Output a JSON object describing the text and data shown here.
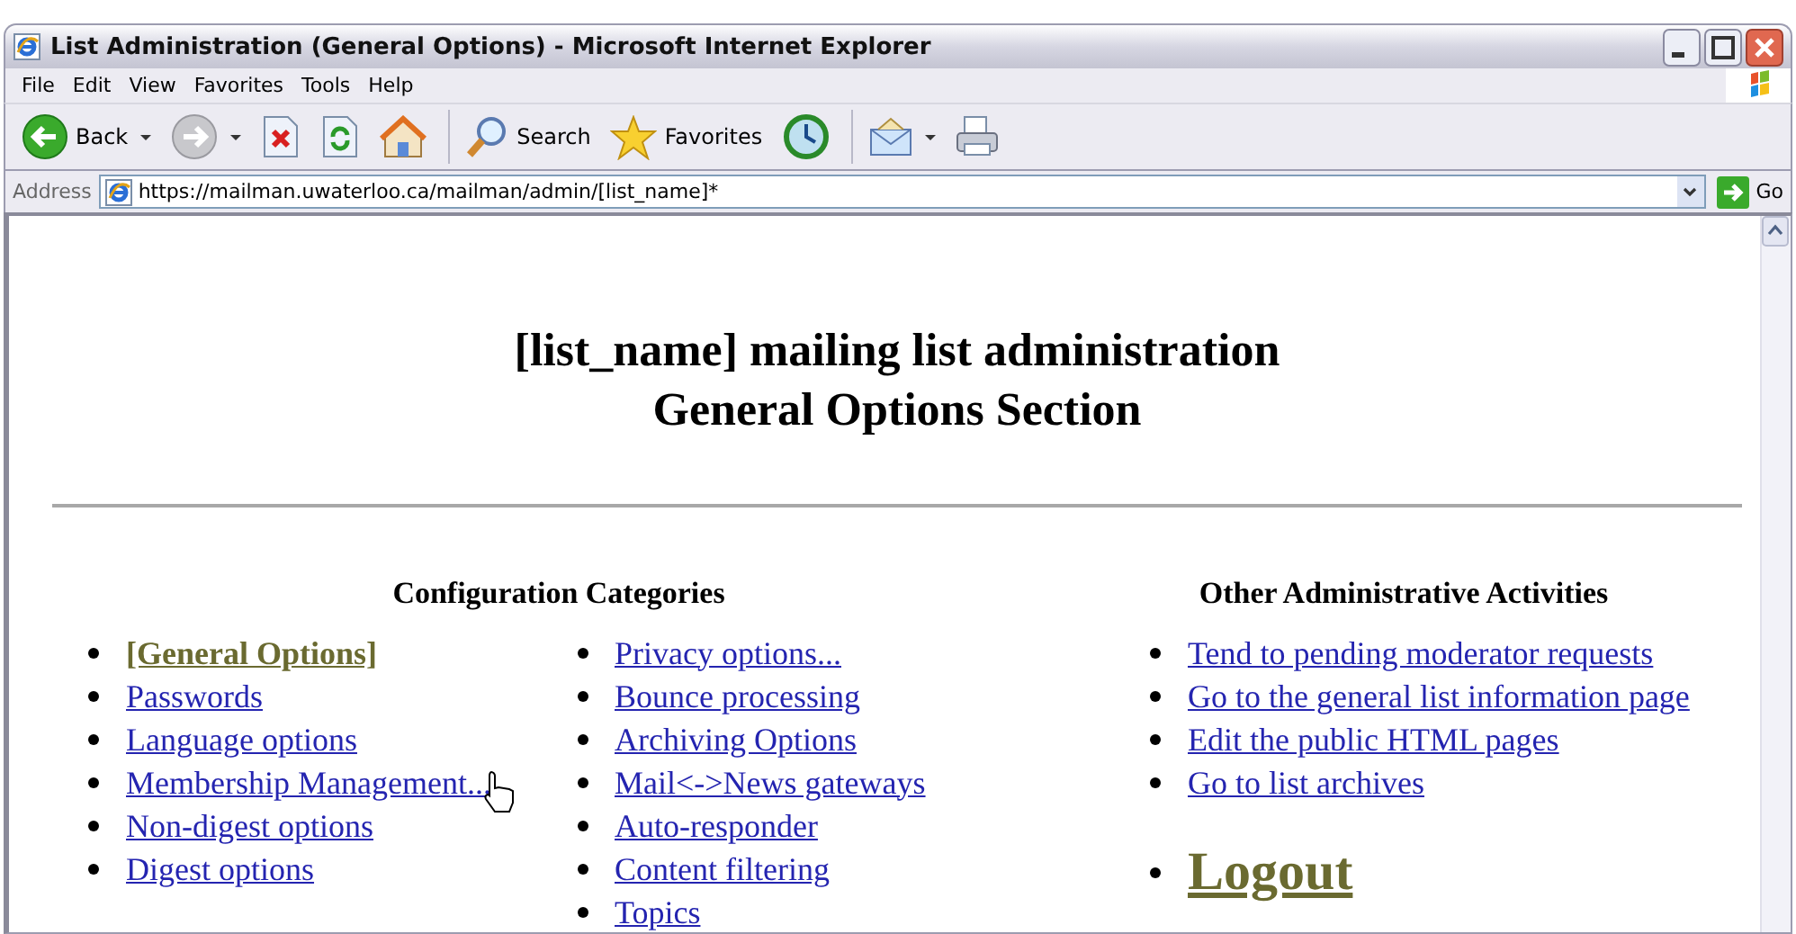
{
  "window": {
    "title": "List Administration (General Options) - Microsoft Internet Explorer"
  },
  "menu": [
    "File",
    "Edit",
    "View",
    "Favorites",
    "Tools",
    "Help"
  ],
  "toolbar": [
    {
      "kind": "back",
      "label": "Back"
    },
    {
      "kind": "forward"
    },
    {
      "kind": "stop"
    },
    {
      "kind": "refresh"
    },
    {
      "kind": "home"
    },
    {
      "kind": "search",
      "label": "Search"
    },
    {
      "kind": "favorites",
      "label": "Favorites"
    },
    {
      "kind": "history"
    },
    {
      "kind": "mail"
    },
    {
      "kind": "print"
    }
  ],
  "address_bar": {
    "label": "Address",
    "value": "https://mailman.uwaterloo.ca/mailman/admin/[list_name]*",
    "go": "Go"
  },
  "page": {
    "heading": [
      "[list_name] mailing list administration",
      "General Options Section"
    ],
    "configuration": {
      "heading": "Configuration Categories",
      "columns": [
        [
          {
            "label": "[General Options]",
            "current": true
          },
          {
            "label": "Passwords",
            "current": false
          },
          {
            "label": "Language options",
            "current": false
          },
          {
            "label": "Membership Management...",
            "current": false
          },
          {
            "label": "Non-digest options",
            "current": false
          },
          {
            "label": "Digest options",
            "current": false
          }
        ],
        [
          {
            "label": "Privacy options...",
            "current": false
          },
          {
            "label": "Bounce processing",
            "current": false
          },
          {
            "label": "Archiving Options",
            "current": false
          },
          {
            "label": "Mail<->News gateways",
            "current": false
          },
          {
            "label": "Auto-responder",
            "current": false
          },
          {
            "label": "Content filtering",
            "current": false
          },
          {
            "label": "Topics",
            "current": false
          }
        ]
      ]
    },
    "other": {
      "heading": "Other Administrative Activities",
      "links": [
        "Tend to pending moderator requests",
        "Go to the general list information page",
        "Edit the public HTML pages",
        "Go to list archives"
      ]
    },
    "logout": {
      "label": "Logout",
      "visited": true
    }
  }
}
